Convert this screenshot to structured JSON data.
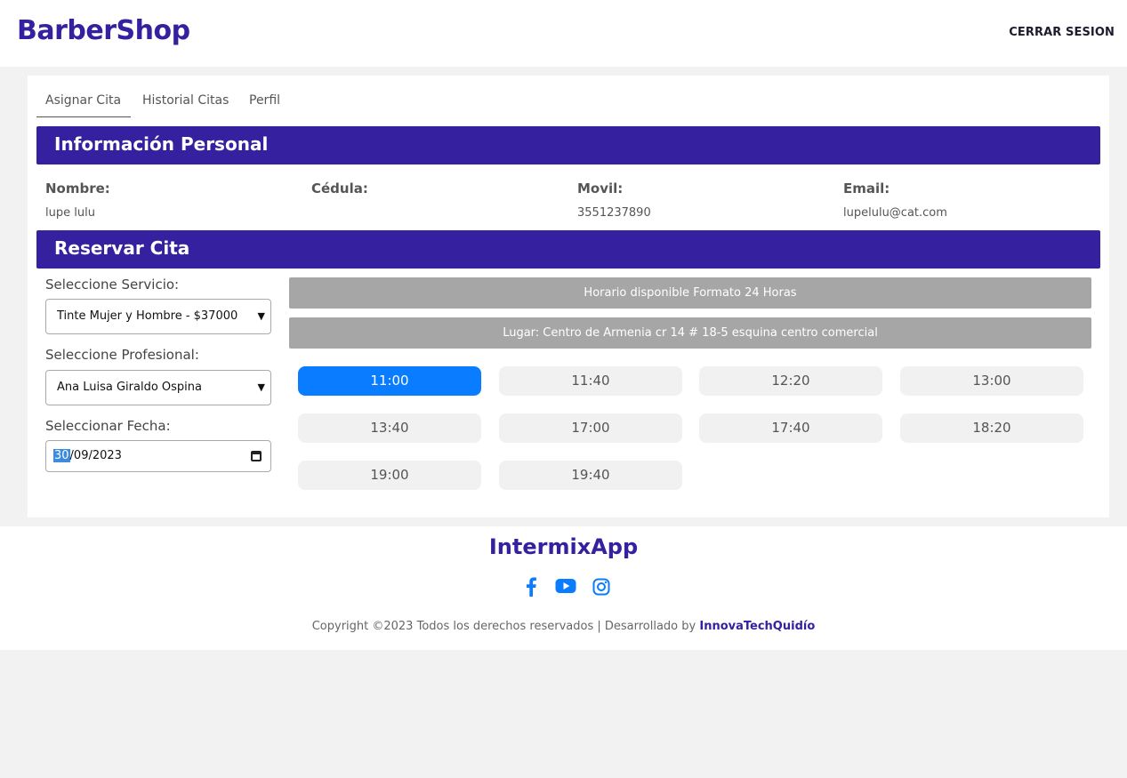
{
  "header": {
    "brand": "BarberShop",
    "logout": "CERRAR SESION"
  },
  "tabs": [
    {
      "label": "Asignar Cita",
      "active": true
    },
    {
      "label": "Historial Citas"
    },
    {
      "label": "Perfil"
    }
  ],
  "personal": {
    "title": "Información Personal",
    "fields": [
      {
        "label": "Nombre:",
        "value": "lupe lulu"
      },
      {
        "label": "Cédula:",
        "value": ""
      },
      {
        "label": "Movil:",
        "value": "3551237890"
      },
      {
        "label": "Email:",
        "value": "lupelulu@cat.com"
      }
    ]
  },
  "reserve": {
    "title": "Reservar Cita",
    "service_label": "Seleccione Servicio:",
    "service_value": "Tinte Mujer y Hombre - $37000",
    "professional_label": "Seleccione Profesional:",
    "professional_value": "Ana Luisa Giraldo Ospina",
    "date_label": "Seleccionar Fecha:",
    "date_day": "30",
    "date_rest": "/09/2023",
    "schedule_note": "Horario disponible Formato 24 Horas",
    "location_note": "Lugar: Centro de Armenia cr 14 # 18-5 esquina centro comercial",
    "slots": [
      "11:00",
      "11:40",
      "12:20",
      "13:00",
      "13:40",
      "17:00",
      "17:40",
      "18:20",
      "19:00",
      "19:40"
    ],
    "selected_slot": "11:00",
    "accent_color": "#0a7cff"
  },
  "footer": {
    "brand": "IntermixApp",
    "social": [
      "facebook-icon",
      "youtube-icon",
      "instagram-icon"
    ],
    "copyright": "Copyright ©2023 Todos los derechos reservados | Desarrollado by ",
    "developer": "InnovaTechQuidío"
  },
  "colors": {
    "primary": "#35209f",
    "muted": "#a6a6a6"
  }
}
